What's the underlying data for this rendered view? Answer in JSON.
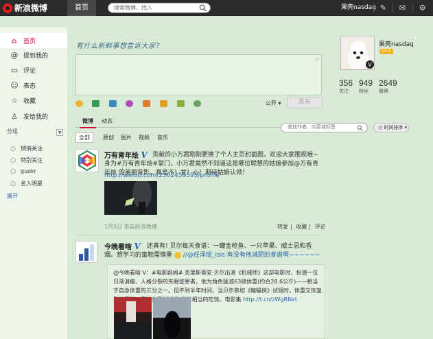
{
  "topbar": {
    "logo_text": "新浪微博",
    "home_label": "首页",
    "search_placeholder": "搜索微博、找人",
    "username": "果壳nasdaq"
  },
  "sidebar": {
    "items": [
      {
        "label": "首页",
        "icon": "home-icon"
      },
      {
        "label": "提到我的",
        "icon": "at-icon"
      },
      {
        "label": "评论",
        "icon": "comment-icon"
      },
      {
        "label": "表态",
        "icon": "smile-icon"
      },
      {
        "label": "收藏",
        "icon": "star-icon"
      },
      {
        "label": "发给我的",
        "icon": "person-icon"
      }
    ],
    "group_header": "分组",
    "groups": [
      "悄悄关注",
      "特别关注",
      "guokr",
      "名人明星"
    ],
    "expand_label": "展开"
  },
  "composer": {
    "prompt": "有什么新鲜事想告诉大家？",
    "visibility": "公开",
    "post_label": "发布"
  },
  "feed_tabs": {
    "tabs": [
      "微博",
      "动态"
    ]
  },
  "feed_search": {
    "placeholder": "查找作者、内容或标签",
    "sort_label": "时间排序"
  },
  "filters": [
    "全部",
    "原创",
    "图片",
    "视频",
    "音乐"
  ],
  "posts": [
    {
      "author": "万有青年烩",
      "text": "贡献的小万君刚刚更换了个人主页封面图，欢迎大家围观哦~身为#万有青年烩#掌门，小万君竟然不知道这是哪位聪慧的姑娘参加@万有青年烩 的美丽背影，真是不！甘！心！期待姑娘认领！",
      "link": "http://weibo.com/2362459595/profile",
      "meta": "1月5日  来自新浪微博",
      "actions": [
        "转发",
        "收藏",
        "评论"
      ]
    },
    {
      "author": "今晚看啥",
      "text": "还真有! 贝尔每天食谱：一罐金枪鱼、一只苹果、威士忌和香烟。想学习的童鞋需慎重",
      "mention": "//@任泽瑶_Isis:有没有他减肥的食谱啊~~~~~~",
      "repost_text": "@今晚看啥 V：#电影剧闻# 克里斯蒂安·贝尔出演《机械师》这部电影时，扮演一位日渐消瘦、人格分裂的失眠症患者，他为角色猛减63磅体重(约合28.6公斤)——相当于自身体重的三分之一。但不到半年时间，当贝尔参加《蝙蝠侠》试镜时，体重又恢复到了原样，导演克里斯托弗·诺兰相当的吃惊。电影集",
      "repost_link": "http://t.cn/zWgRNxt"
    }
  ],
  "profile": {
    "name": "果壳nasdaq",
    "level": "Lv.1",
    "stats": [
      {
        "value": "356",
        "label": "关注"
      },
      {
        "value": "949",
        "label": "粉丝"
      },
      {
        "value": "2649",
        "label": "微博"
      }
    ]
  },
  "colors": {
    "accent": "#dd0033",
    "link": "#2a66a8",
    "background": "#d9ead7"
  }
}
